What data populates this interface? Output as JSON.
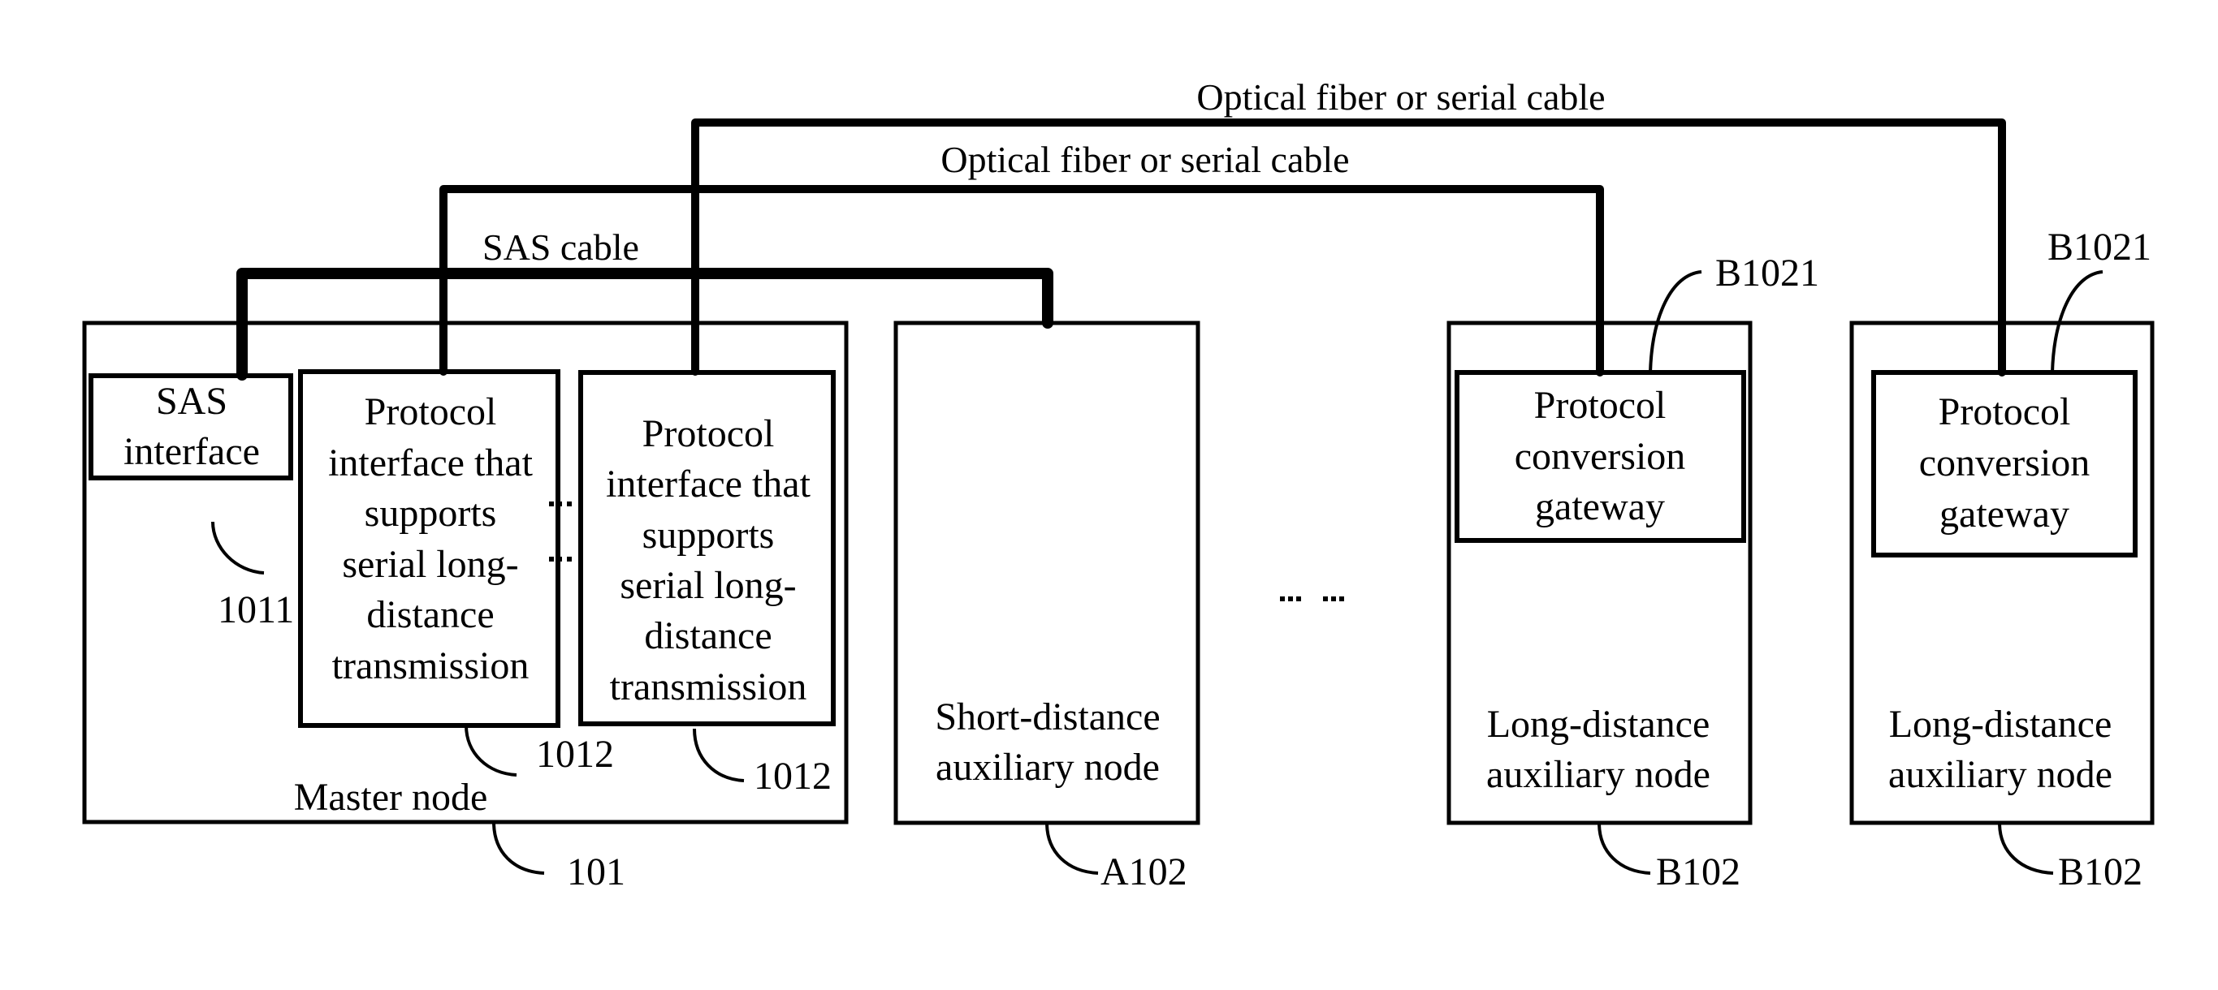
{
  "cables": {
    "sas": "SAS cable",
    "optical_1": "Optical fiber or serial cable",
    "optical_2": "Optical fiber or serial cable"
  },
  "master_node": {
    "label": "Master node",
    "ref": "101",
    "sas_interface": {
      "lines": [
        "SAS",
        "interface"
      ],
      "ref": "1011"
    },
    "protocol_interfaces": [
      {
        "lines": [
          "Protocol",
          "interface that",
          "supports",
          "serial long-",
          "distance",
          "transmission"
        ],
        "ref": "1012"
      },
      {
        "lines": [
          "Protocol",
          "interface that",
          "supports",
          "serial long-",
          "distance",
          "transmission"
        ],
        "ref": "1012"
      }
    ],
    "interface_ellipsis": "..."
  },
  "short_distance_node": {
    "lines": [
      "Short-distance",
      "auxiliary node"
    ],
    "ref": "A102"
  },
  "nodes_ellipsis": "... ...",
  "long_distance_nodes": [
    {
      "lines": [
        "Long-distance",
        "auxiliary node"
      ],
      "ref": "B102",
      "gateway": {
        "lines": [
          "Protocol",
          "conversion",
          "gateway"
        ],
        "ref": "B1021"
      }
    },
    {
      "lines": [
        "Long-distance",
        "auxiliary node"
      ],
      "ref": "B102",
      "gateway": {
        "lines": [
          "Protocol",
          "conversion",
          "gateway"
        ],
        "ref": "B1021"
      }
    }
  ]
}
